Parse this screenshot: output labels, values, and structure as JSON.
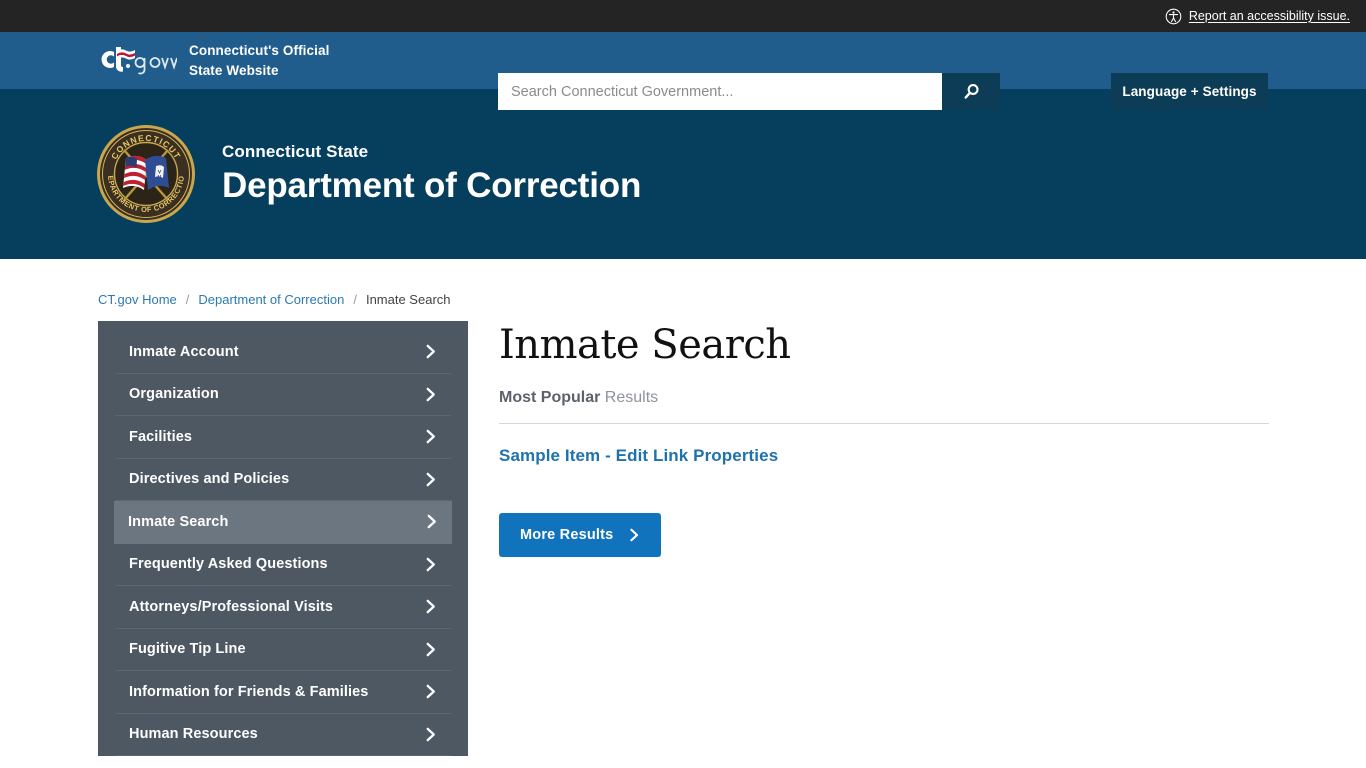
{
  "topbar": {
    "accessibility_link": "Report an accessibility issue.",
    "accessibility_icon": "accessibility-icon"
  },
  "utility": {
    "logo_text": "Ct.gov",
    "tagline_line1": "Connecticut's Official",
    "tagline_line2": "State Website",
    "search_placeholder": "Search Connecticut Government...",
    "search_value": "",
    "search_icon": "search-icon",
    "language_settings_label": "Language + Settings"
  },
  "agency": {
    "seal_alt": "Connecticut Department of Correction seal",
    "seal_text_top": "CONNECTICUT",
    "seal_text_bottom": "DEPARTMENT OF CORRECTION",
    "subtitle": "Connecticut State",
    "title": "Department of Correction"
  },
  "breadcrumb": {
    "items": [
      {
        "label": "CT.gov Home",
        "link": true
      },
      {
        "label": "Department of Correction",
        "link": true
      },
      {
        "label": "Inmate Search",
        "link": false
      }
    ],
    "separator": "/"
  },
  "sidebar": {
    "items": [
      {
        "label": "Inmate Account",
        "active": false
      },
      {
        "label": "Organization",
        "active": false
      },
      {
        "label": "Facilities",
        "active": false
      },
      {
        "label": "Directives and Policies",
        "active": false
      },
      {
        "label": "Inmate Search",
        "active": true
      },
      {
        "label": "Frequently Asked Questions",
        "active": false
      },
      {
        "label": "Attorneys/Professional Visits",
        "active": false
      },
      {
        "label": "Fugitive Tip Line",
        "active": false
      },
      {
        "label": "Information for Friends & Families",
        "active": false
      },
      {
        "label": "Human Resources",
        "active": false
      }
    ]
  },
  "main": {
    "page_title": "Inmate Search",
    "results_label_bold": "Most Popular",
    "results_label_rest": " Results",
    "result_link": "Sample Item - Edit Link Properties",
    "more_button_label": "More Results"
  },
  "colors": {
    "topbar_bg": "#242424",
    "utility_bg": "#215d8c",
    "agency_bg": "#063e5e",
    "sidebar_bg": "#4e5862",
    "sidebar_active_bg": "#6c7680",
    "accent_blue": "#1073bc",
    "link_blue": "#1f72ad",
    "button_dark": "#0d3c56"
  }
}
